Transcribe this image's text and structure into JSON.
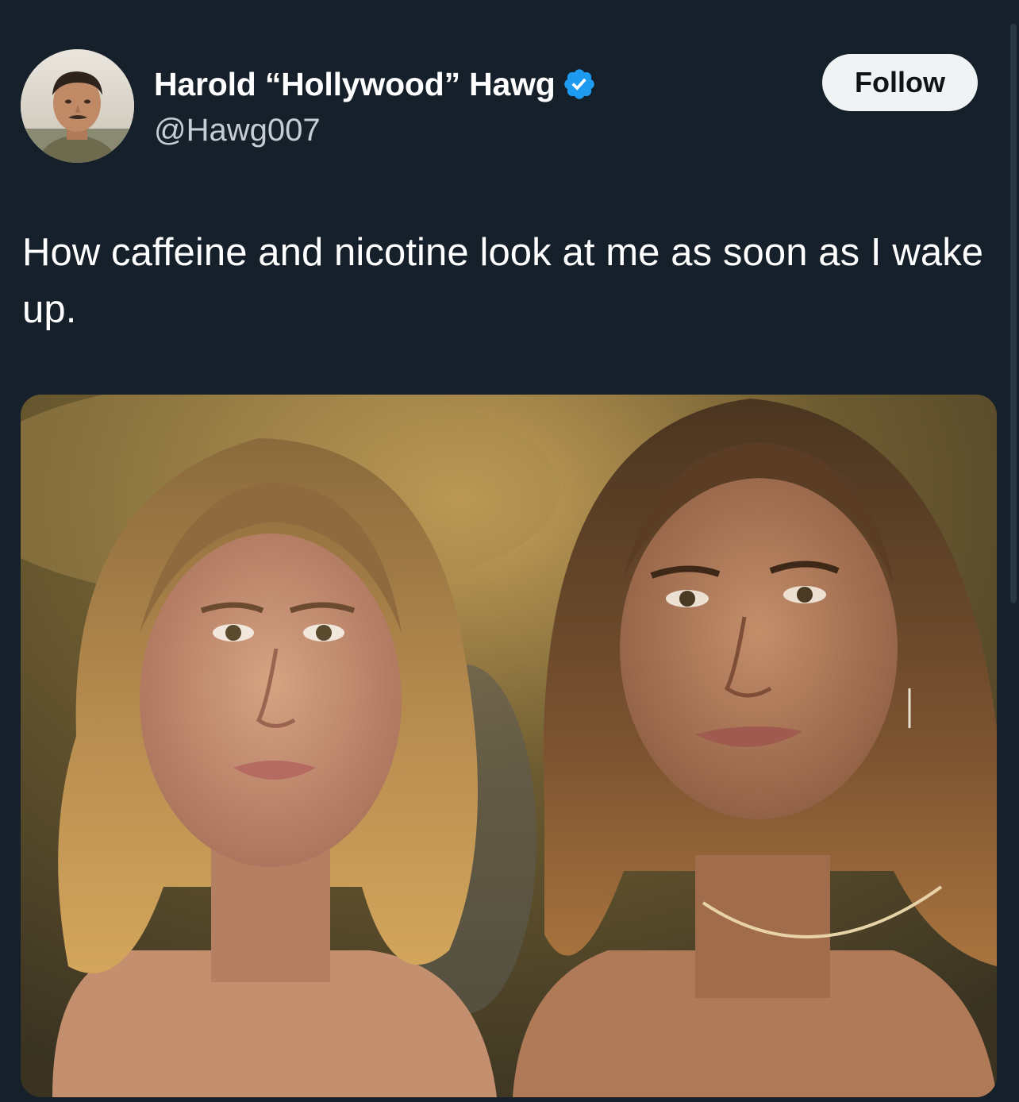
{
  "tweet": {
    "author": {
      "display_name": "Harold “Hollywood” Hawg",
      "handle": "@Hawg007",
      "verified": true,
      "avatar_icon": "profile-photo"
    },
    "follow_label": "Follow",
    "text": "How caffeine and nicotine look at me as soon as I wake up.",
    "media": {
      "type": "photo",
      "alt": ""
    }
  },
  "colors": {
    "background": "#15202b",
    "text_primary": "#ffffff",
    "text_secondary": "#c6cdd4",
    "verified_blue": "#1d9bf0",
    "follow_bg": "#eff3f4"
  }
}
